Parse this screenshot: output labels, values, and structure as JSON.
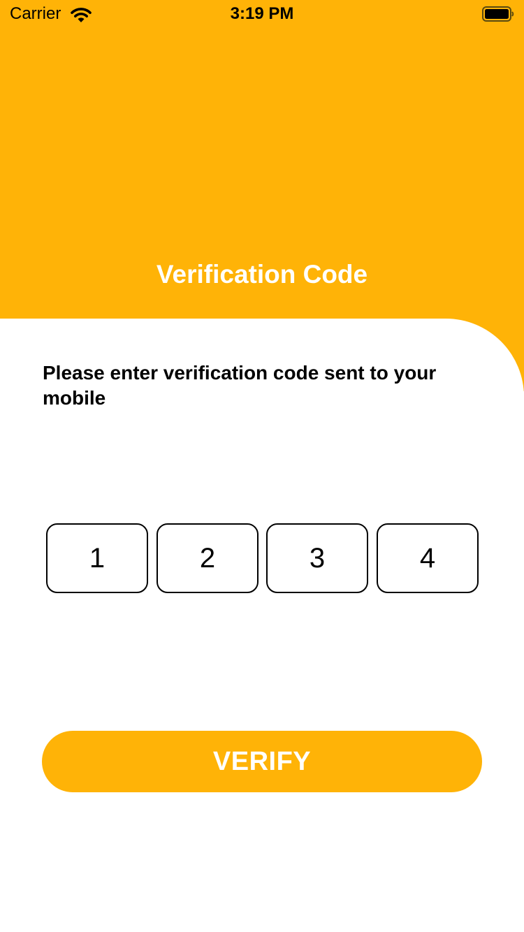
{
  "status_bar": {
    "carrier": "Carrier",
    "time": "3:19 PM"
  },
  "header": {
    "title": "Verification Code",
    "background_color": "#FFB307"
  },
  "instruction": "Please enter verification code sent to your mobile",
  "otp": {
    "digits": [
      "1",
      "2",
      "3",
      "4"
    ]
  },
  "verify_button": {
    "label": "VERIFY",
    "color": "#FFB307"
  }
}
